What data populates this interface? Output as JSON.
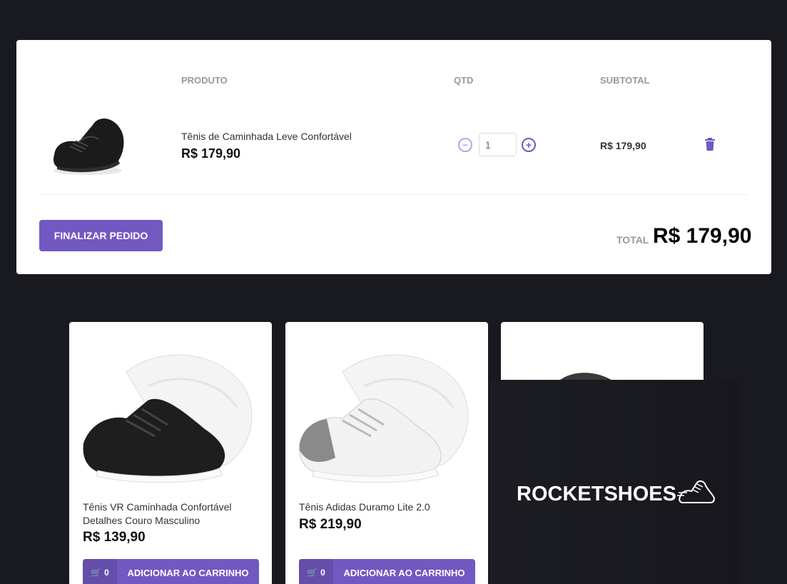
{
  "cart": {
    "headers": {
      "product": "PRODUTO",
      "qty": "QTD",
      "subtotal": "SUBTOTAL"
    },
    "item": {
      "name": "Tênis de Caminhada Leve Confortável",
      "price": "R$ 179,90",
      "quantity": "1",
      "subtotal": "R$ 179,90"
    },
    "finish_label": "FINALIZAR PEDIDO",
    "total_label": "TOTAL",
    "total_value": "R$ 179,90"
  },
  "products": [
    {
      "name": "Tênis VR Caminhada Confortável Detalhes Couro Masculino",
      "price": "R$ 139,90",
      "cart_count": "0",
      "add_label": "ADICIONAR AO CARRINHO"
    },
    {
      "name": "Tênis Adidas Duramo Lite 2.0",
      "price": "R$ 219,90",
      "cart_count": "0",
      "add_label": "ADICIONAR AO CARRINHO"
    }
  ],
  "header": {
    "logo": "ROCKETSHOES"
  },
  "colors": {
    "accent": "#7159c1",
    "background": "#191920"
  }
}
